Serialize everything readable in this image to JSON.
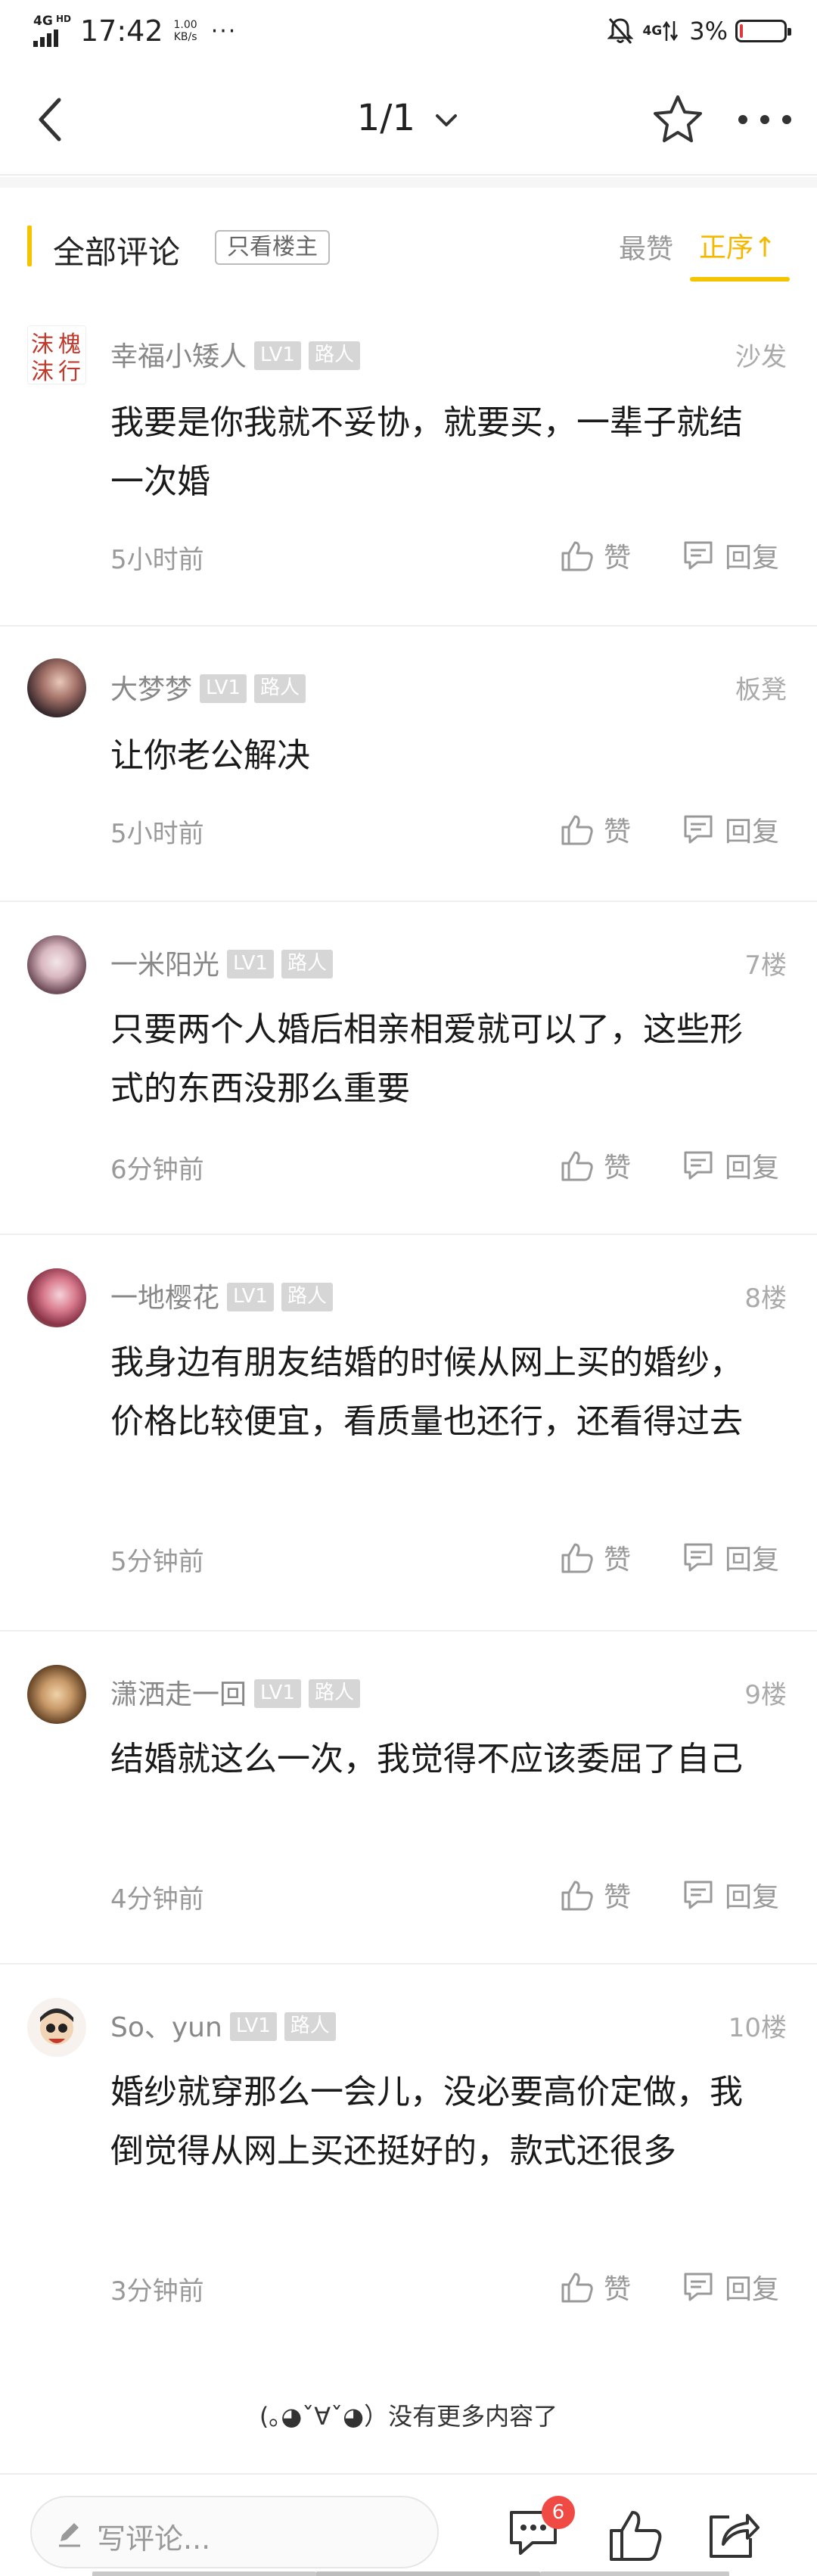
{
  "status_bar": {
    "network": "4G",
    "network_sub": "HD",
    "time": "17:42",
    "speed_value": "1.00",
    "speed_unit": "KB/s",
    "dots": "···",
    "network2": "4G",
    "battery": "3%",
    "battery_level": 0.03,
    "battery_fill_color": "#e0383e"
  },
  "nav": {
    "title": "1/1",
    "back_icon": "chevron-left-icon",
    "star_icon": "star-outline-icon",
    "more_icon": "more-dots-icon"
  },
  "comments_header": {
    "title": "全部评论",
    "owner_only": "只看楼主",
    "sort_hot": "最赞",
    "sort_order": "正序↑",
    "accent_color": "#f5c400"
  },
  "comments": [
    {
      "name": "幸福小矮人",
      "level": "LV1",
      "role": "路人",
      "floor": "沙发",
      "text": "我要是你我就不妥协，就要买，一辈子就结一次婚",
      "time": "5小时前",
      "like": "赞",
      "reply": "回复"
    },
    {
      "name": "大梦梦",
      "level": "LV1",
      "role": "路人",
      "floor": "板凳",
      "text": "让你老公解决",
      "time": "5小时前",
      "like": "赞",
      "reply": "回复"
    },
    {
      "name": "一米阳光",
      "level": "LV1",
      "role": "路人",
      "floor": "7楼",
      "text": "只要两个人婚后相亲相爱就可以了，这些形式的东西没那么重要",
      "time": "6分钟前",
      "like": "赞",
      "reply": "回复"
    },
    {
      "name": "一地樱花",
      "level": "LV1",
      "role": "路人",
      "floor": "8楼",
      "text": "我身边有朋友结婚的时候从网上买的婚纱，价格比较便宜，看质量也还行，还看得过去",
      "time": "5分钟前",
      "like": "赞",
      "reply": "回复"
    },
    {
      "name": "潇洒走一回",
      "level": "LV1",
      "role": "路人",
      "floor": "9楼",
      "text": "结婚就这么一次，我觉得不应该委屈了自己",
      "time": "4分钟前",
      "like": "赞",
      "reply": "回复"
    },
    {
      "name": "So、yun",
      "level": "LV1",
      "role": "路人",
      "floor": "10楼",
      "text": "婚纱就穿那么一会儿，没必要高价定做，我倒觉得从网上买还挺好的，款式还很多",
      "time": "3分钟前",
      "like": "赞",
      "reply": "回复"
    }
  ],
  "avatar_text_1a": "沫",
  "avatar_text_1b": "槐",
  "avatar_text_1c": "沫",
  "avatar_text_1d": "行",
  "no_more": "(｡◕ˇ∀ˇ◕）没有更多内容了",
  "bottom_bar": {
    "placeholder": "写评论...",
    "comment_count": "6",
    "badge_color": "#f04a44"
  }
}
